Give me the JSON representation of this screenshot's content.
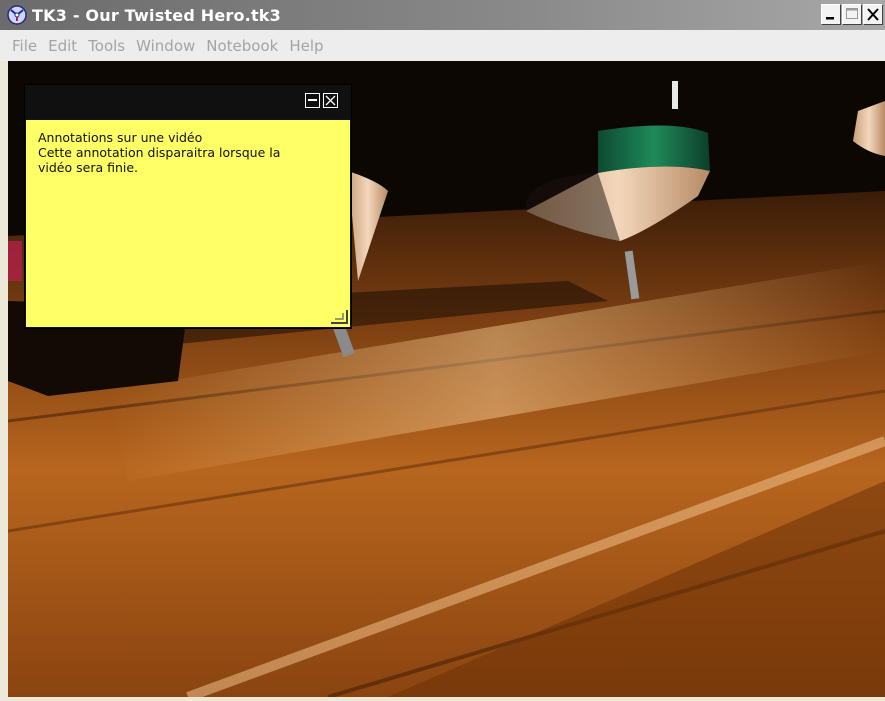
{
  "window": {
    "title": "TK3 - Our Twisted Hero.tk3",
    "app_icon": "tk3-app-icon",
    "controls": [
      "minimize-icon",
      "maximize-icon",
      "close-icon"
    ]
  },
  "menu": {
    "items": [
      {
        "label": "File"
      },
      {
        "label": "Edit"
      },
      {
        "label": "Tools"
      },
      {
        "label": "Window"
      },
      {
        "label": "Notebook"
      },
      {
        "label": "Help"
      }
    ],
    "state": "disabled"
  },
  "video": {
    "scene": "spinning tops on wooden floor"
  },
  "annotation": {
    "lines": [
      "Annotations sur une vidéo",
      "Cette annotation disparaitra lorsque la",
      "vidéo sera finie."
    ],
    "background_color": "#ffff66",
    "buttons": [
      "collapse-icon",
      "close-icon"
    ]
  },
  "colors": {
    "titlebar": "#8a8a8a",
    "menu_text_disabled": "#a4a4a4",
    "note_yellow": "#ffff66"
  }
}
